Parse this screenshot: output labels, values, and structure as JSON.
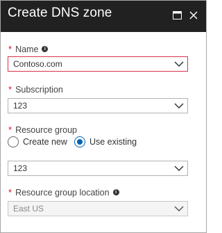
{
  "window": {
    "title": "Create DNS zone",
    "buttons": [
      "maximize-icon",
      "close-icon"
    ]
  },
  "form": {
    "required_marker": "*",
    "name": {
      "label": "Name",
      "value": "Contoso.com",
      "has_info_icon": true,
      "state": "error"
    },
    "subscription": {
      "label": "Subscription",
      "value": "123"
    },
    "resource_group": {
      "label": "Resource group",
      "options": [
        "Create new",
        "Use existing"
      ],
      "option_create_new": "Create new",
      "option_use_existing": "Use existing",
      "selected": "Use existing",
      "value": "123"
    },
    "resource_group_location": {
      "label": "Resource group location",
      "value": "East US",
      "has_info_icon": true,
      "disabled": true
    }
  },
  "colors": {
    "titlebar_bg": "#212121",
    "required_star": "#e00b1c",
    "error_border": "#d6334a",
    "radio_accent": "#0063b1"
  }
}
